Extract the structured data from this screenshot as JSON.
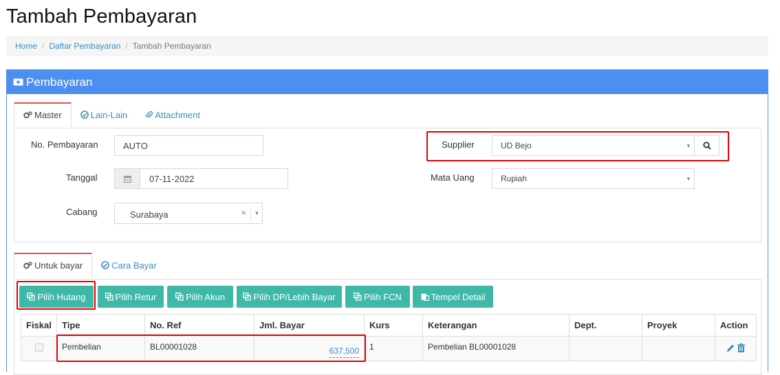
{
  "page": {
    "title": "Tambah Pembayaran"
  },
  "breadcrumb": {
    "home": "Home",
    "list": "Daftar Pembayaran",
    "current": "Tambah Pembayaran",
    "sep": "/"
  },
  "panel": {
    "title": "Pembayaran"
  },
  "tabs": [
    {
      "label": "Master"
    },
    {
      "label": "Lain-Lain"
    },
    {
      "label": "Attachment"
    }
  ],
  "form": {
    "no_pembayaran_label": "No. Pembayaran",
    "no_pembayaran_value": "AUTO",
    "tanggal_label": "Tanggal",
    "tanggal_value": "07-11-2022",
    "cabang_label": "Cabang",
    "cabang_value": "Surabaya",
    "supplier_label": "Supplier",
    "supplier_value": "UD Bejo",
    "mata_uang_label": "Mata Uang",
    "mata_uang_value": "Rupiah"
  },
  "subtabs": [
    {
      "label": "Untuk bayar"
    },
    {
      "label": "Cara Bayar"
    }
  ],
  "buttons": [
    {
      "label": "Pilih Hutang"
    },
    {
      "label": "Pilih Retur"
    },
    {
      "label": "Pilih Akun"
    },
    {
      "label": "Pilih DP/Lebih Bayar"
    },
    {
      "label": "Pilih FCN"
    },
    {
      "label": "Tempel Detail"
    }
  ],
  "table": {
    "headers": [
      "Fiskal",
      "Tipe",
      "No. Ref",
      "Jml. Bayar",
      "Kurs",
      "Keterangan",
      "Dept.",
      "Proyek",
      "Action"
    ],
    "rows": [
      {
        "tipe": "Pembelian",
        "no_ref": "BL00001028",
        "jml_bayar": "637,500",
        "kurs": "1",
        "keterangan": "Pembelian BL00001028",
        "dept": "",
        "proyek": ""
      }
    ]
  },
  "colors": {
    "primary": "#4d8ff0",
    "teal_button": "#3fb8a8",
    "highlight": "#e10000",
    "link": "#3c8dbc"
  }
}
